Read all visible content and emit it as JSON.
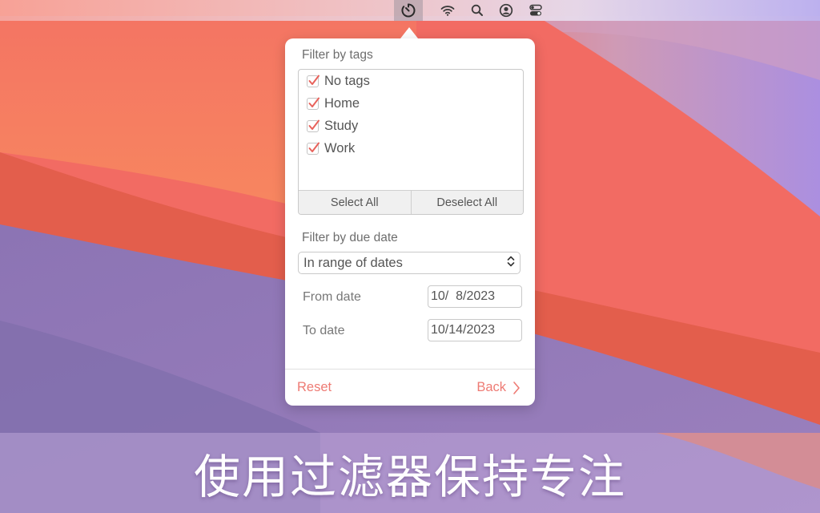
{
  "menubar": {
    "icons": [
      {
        "name": "timer-icon",
        "active": true
      },
      {
        "name": "wifi-icon",
        "active": false
      },
      {
        "name": "search-icon",
        "active": false
      },
      {
        "name": "user-icon",
        "active": false
      },
      {
        "name": "control-center-icon",
        "active": false
      }
    ]
  },
  "popover": {
    "tags_section": {
      "label": "Filter by tags",
      "items": [
        {
          "label": "No tags",
          "checked": true
        },
        {
          "label": "Home",
          "checked": true
        },
        {
          "label": "Study",
          "checked": true
        },
        {
          "label": "Work",
          "checked": true
        }
      ],
      "select_all_label": "Select All",
      "deselect_all_label": "Deselect All"
    },
    "date_section": {
      "label": "Filter by due date",
      "mode_selected": "In range of dates",
      "from_label": "From date",
      "from_value": "10/  8/2023",
      "to_label": "To date",
      "to_value": "10/14/2023"
    },
    "footer": {
      "reset_label": "Reset",
      "back_label": "Back"
    }
  },
  "caption": "使用过滤器保持专注",
  "colors": {
    "accent": "#ee7b74",
    "checkmark": "#e8625b"
  }
}
